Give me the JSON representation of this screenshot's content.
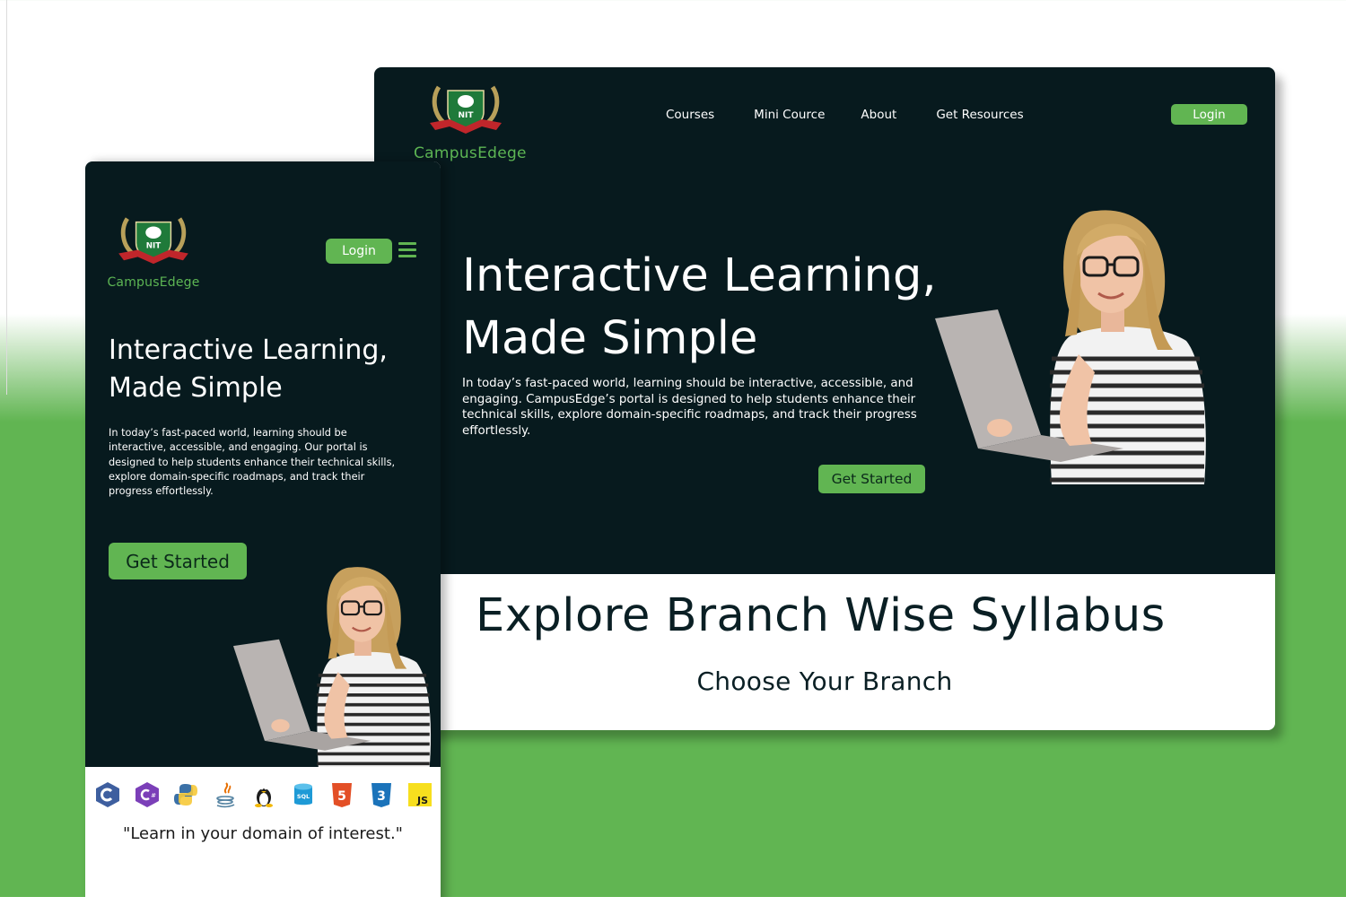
{
  "brand": {
    "name_desktop": "CampusEdege",
    "name_mobile": "CampusEdege",
    "emblem_text": "NIT"
  },
  "colors": {
    "accent": "#61b552",
    "hero_bg": "#071a1e",
    "heading_dark": "#0a1f24"
  },
  "desktop": {
    "nav": [
      "Courses",
      "Mini Cource",
      "About",
      "Get Resources"
    ],
    "login_label": "Login",
    "hero_title_line1": "Interactive Learning,",
    "hero_title_line2": "Made Simple",
    "hero_desc": "In today’s fast-paced world, learning should be interactive, accessible, and engaging. CampusEdge’s portal is designed to help students enhance their technical skills, explore domain-specific roadmaps, and track their progress effortlessly.",
    "cta_label": "Get Started",
    "syllabus_title": "Explore Branch Wise Syllabus",
    "syllabus_subtitle": "Choose Your Branch"
  },
  "mobile": {
    "login_label": "Login",
    "hero_title_line1": "Interactive Learning,",
    "hero_title_line2": "Made Simple",
    "hero_desc": "In today’s fast-paced world, learning should be interactive, accessible, and engaging. Our portal is designed to help students enhance their technical skills, explore domain-specific roadmaps, and track their progress effortlessly.",
    "cta_label": "Get Started",
    "tech_icons": [
      "c-icon",
      "csharp-icon",
      "python-icon",
      "java-icon",
      "linux-icon",
      "sql-icon",
      "html5-icon",
      "css3-icon",
      "javascript-icon"
    ],
    "sql_label": "SQL",
    "js_label": "JS",
    "html_label": "5",
    "css_label": "3",
    "quote": "\"Learn in your domain of interest.\""
  }
}
